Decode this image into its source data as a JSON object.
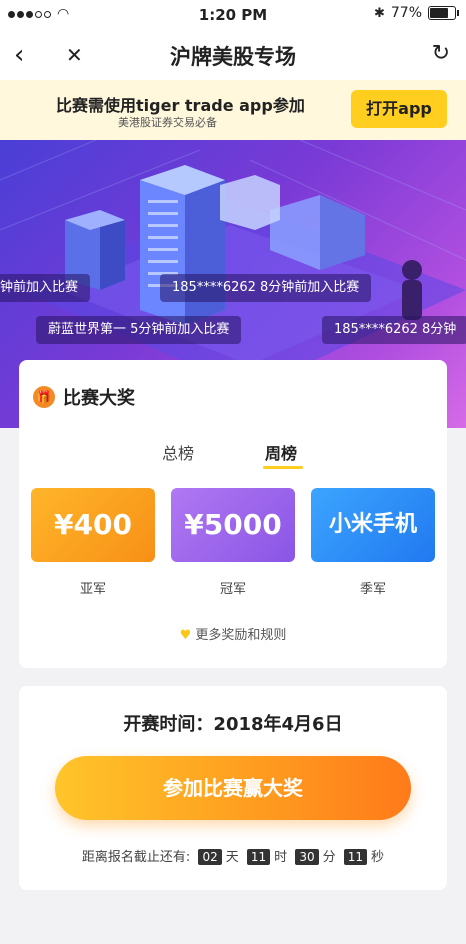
{
  "status_bar": {
    "time": "1:20 PM",
    "battery": "77%"
  },
  "nav": {
    "title": "沪牌美股专场",
    "back_icon": "‹",
    "close_icon": "✕",
    "refresh_icon": "↻"
  },
  "banner": {
    "title": "比赛需使用tiger trade app参加",
    "subtitle": "美港股证券交易必备",
    "open_label": "打开app"
  },
  "marquees": [
    "钟前加入比赛",
    "185****6262 8分钟前加入比赛",
    "蔚蓝世界第一 5分钟前加入比赛",
    "185****6262 8分钟"
  ],
  "prize_card": {
    "title": "比赛大奖",
    "tabs": [
      "总榜",
      "周榜"
    ],
    "active_tab": "周榜",
    "prizes": [
      {
        "amount": "¥400",
        "label": "亚军",
        "color": "#f7a21a"
      },
      {
        "amount": "¥5000",
        "label": "冠军",
        "color": "#9a63ec"
      },
      {
        "amount": "小米手机",
        "label": "季军",
        "color": "#2b8ef5"
      }
    ],
    "more_text": "更多奖励和规则"
  },
  "signup": {
    "start_label": "开赛时间：",
    "start_date": "2018年4月6日",
    "join_button": "参加比赛赢大奖",
    "countdown_prefix": "距离报名截止还有:",
    "days": "02",
    "days_unit": "天",
    "hours": "11",
    "hours_unit": "时",
    "minutes": "30",
    "minutes_unit": "分",
    "seconds": "11",
    "seconds_unit": "秒"
  }
}
